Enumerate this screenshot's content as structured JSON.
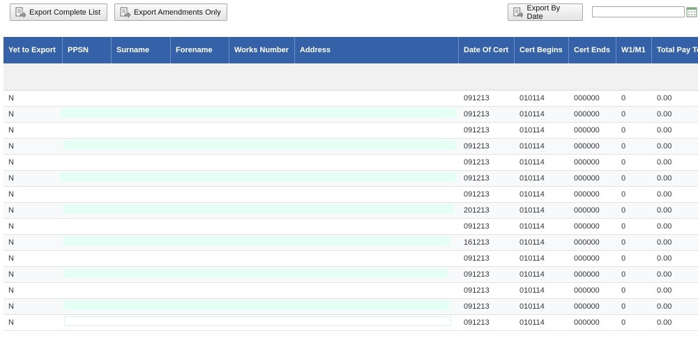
{
  "toolbar": {
    "export_complete_label": "Export Complete List",
    "export_amendments_label": "Export Amendments Only",
    "export_by_date_label": "Export By Date",
    "date_value": ""
  },
  "columns": [
    "Yet to Export",
    "PPSN",
    "Surname",
    "Forename",
    "Works Number",
    "Address",
    "Date Of Cert",
    "Cert Begins",
    "Cert Ends",
    "W1/M1",
    "Total Pay To Date"
  ],
  "rows": [
    {
      "yet": "N",
      "date_of_cert": "091213",
      "cert_begins": "010114",
      "cert_ends": "000000",
      "w1m1": "0",
      "total_pay": "0.00"
    },
    {
      "yet": "N",
      "date_of_cert": "091213",
      "cert_begins": "010114",
      "cert_ends": "000000",
      "w1m1": "0",
      "total_pay": "0.00"
    },
    {
      "yet": "N",
      "date_of_cert": "091213",
      "cert_begins": "010114",
      "cert_ends": "000000",
      "w1m1": "0",
      "total_pay": "0.00"
    },
    {
      "yet": "N",
      "date_of_cert": "091213",
      "cert_begins": "010114",
      "cert_ends": "000000",
      "w1m1": "0",
      "total_pay": "0.00"
    },
    {
      "yet": "N",
      "date_of_cert": "091213",
      "cert_begins": "010114",
      "cert_ends": "000000",
      "w1m1": "0",
      "total_pay": "0.00"
    },
    {
      "yet": "N",
      "date_of_cert": "091213",
      "cert_begins": "010114",
      "cert_ends": "000000",
      "w1m1": "0",
      "total_pay": "0.00"
    },
    {
      "yet": "N",
      "date_of_cert": "091213",
      "cert_begins": "010114",
      "cert_ends": "000000",
      "w1m1": "0",
      "total_pay": "0.00"
    },
    {
      "yet": "N",
      "date_of_cert": "201213",
      "cert_begins": "010114",
      "cert_ends": "000000",
      "w1m1": "0",
      "total_pay": "0.00"
    },
    {
      "yet": "N",
      "date_of_cert": "091213",
      "cert_begins": "010114",
      "cert_ends": "000000",
      "w1m1": "0",
      "total_pay": "0.00"
    },
    {
      "yet": "N",
      "date_of_cert": "161213",
      "cert_begins": "010114",
      "cert_ends": "000000",
      "w1m1": "0",
      "total_pay": "0.00"
    },
    {
      "yet": "N",
      "date_of_cert": "091213",
      "cert_begins": "010114",
      "cert_ends": "000000",
      "w1m1": "0",
      "total_pay": "0.00"
    },
    {
      "yet": "N",
      "date_of_cert": "091213",
      "cert_begins": "010114",
      "cert_ends": "000000",
      "w1m1": "0",
      "total_pay": "0.00"
    },
    {
      "yet": "N",
      "date_of_cert": "091213",
      "cert_begins": "010114",
      "cert_ends": "000000",
      "w1m1": "0",
      "total_pay": "0.00"
    },
    {
      "yet": "N",
      "date_of_cert": "091213",
      "cert_begins": "010114",
      "cert_ends": "000000",
      "w1m1": "0",
      "total_pay": "0.00"
    },
    {
      "yet": "N",
      "date_of_cert": "091213",
      "cert_begins": "010114",
      "cert_ends": "000000",
      "w1m1": "0",
      "total_pay": "0.00"
    }
  ],
  "icons": {
    "export_icon": "export-document-icon",
    "calendar_icon": "calendar-icon"
  },
  "colors": {
    "header_bg": "#3461a8",
    "redaction": "#e6fff4"
  }
}
